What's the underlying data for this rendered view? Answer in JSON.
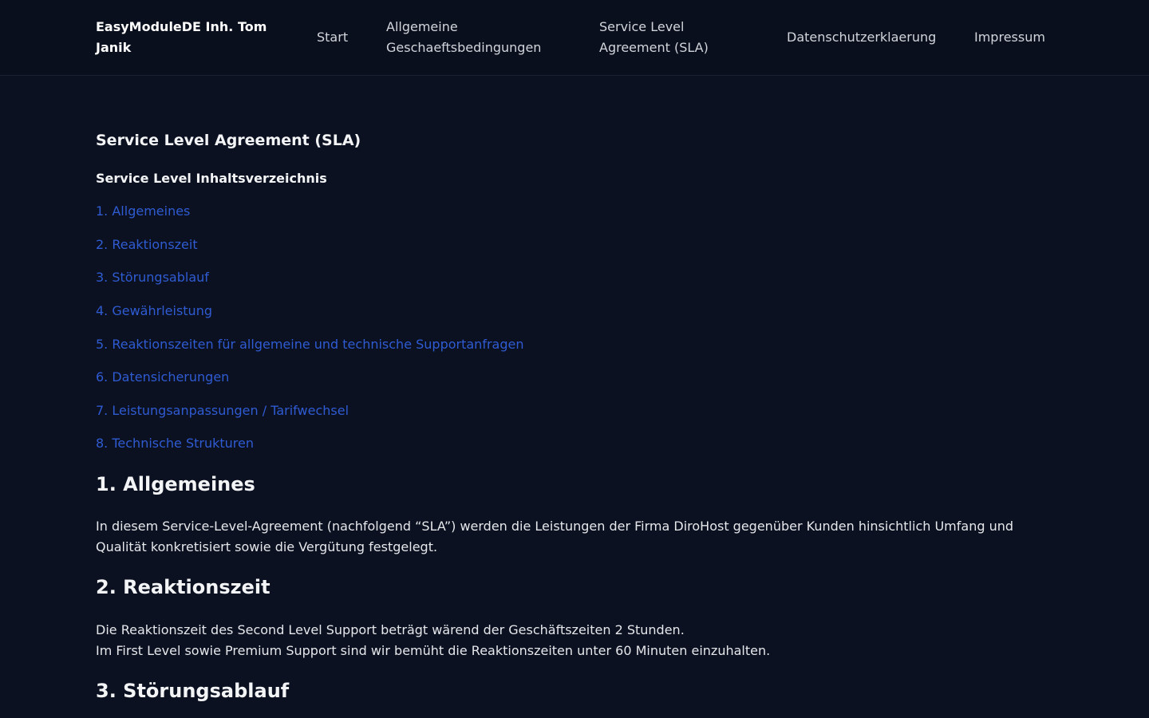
{
  "header": {
    "brand": "EasyModuleDE Inh. Tom Janik",
    "nav": [
      "Start",
      "Allgemeine Geschaeftsbedingungen",
      "Service Level Agreement (SLA)",
      "Datenschutzerklaerung",
      "Impressum"
    ]
  },
  "page": {
    "title": "Service Level Agreement (SLA)",
    "toc_title": "Service Level Inhaltsverzeichnis",
    "toc": [
      "1. Allgemeines",
      "2. Reaktionszeit",
      "3. Störungsablauf",
      "4. Gewährleistung",
      "5. Reaktionszeiten für allgemeine und technische Supportanfragen",
      "6. Datensicherungen",
      "7. Leistungsanpassungen / Tarifwechsel",
      "8. Technische Strukturen"
    ]
  },
  "sections": [
    {
      "heading": "1. Allgemeines",
      "text": "In diesem Service-Level-Agreement (nachfolgend “SLA”) werden die Leistungen der Firma DiroHost gegenüber Kunden hinsichtlich Umfang und Qualität konkretisiert sowie die Vergütung festgelegt."
    },
    {
      "heading": "2. Reaktionszeit",
      "line1": "Die Reaktionszeit des Second Level Support beträgt wärend der Geschäftszeiten 2 Stunden.",
      "line2": "Im First Level sowie Premium Support sind wir bemüht die Reaktionszeiten unter 60 Minuten einzuhalten."
    },
    {
      "heading": "3. Störungsablauf"
    }
  ],
  "colors": {
    "background": "#0b1120",
    "link": "#2f5bd3"
  }
}
